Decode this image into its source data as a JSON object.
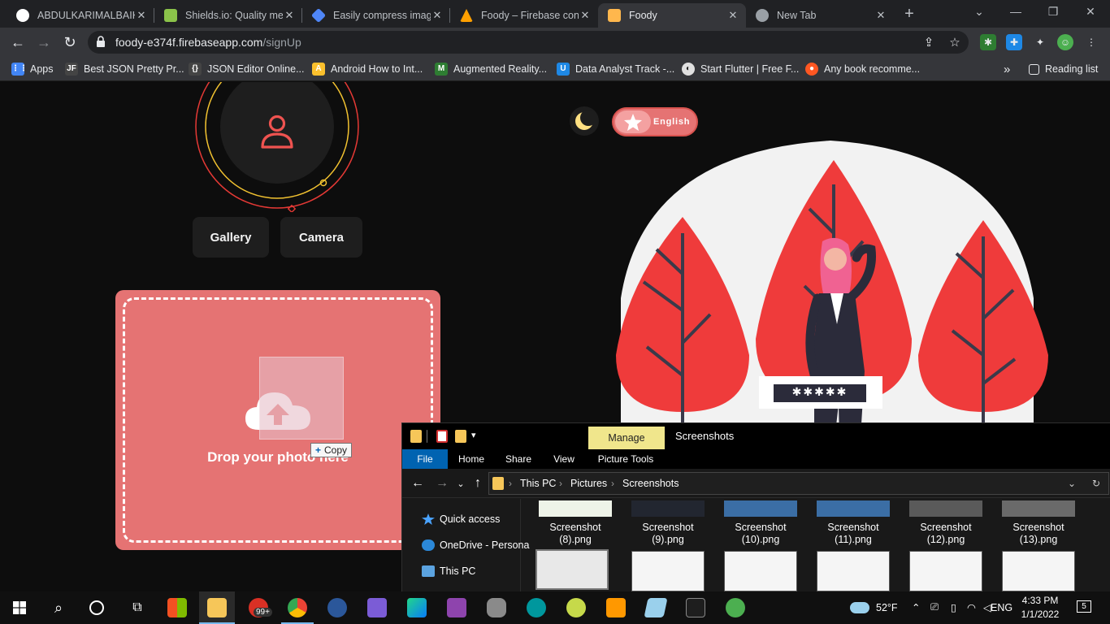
{
  "browser": {
    "tabs": [
      {
        "title": "ABDULKARIMALBAIK/",
        "favicon_color": "#ffffff",
        "active": false
      },
      {
        "title": "Shields.io: Quality met",
        "favicon_color": "#8bc34a",
        "active": false
      },
      {
        "title": "Easily compress image",
        "favicon_color": "#4f86f7",
        "active": false
      },
      {
        "title": "Foody – Firebase cons",
        "favicon_color": "#ffa000",
        "active": false
      },
      {
        "title": "Foody",
        "favicon_color": "#ffb74d",
        "active": true
      },
      {
        "title": "New Tab",
        "favicon_color": "#9aa0a6",
        "active": false
      }
    ],
    "tab_close": "✕",
    "new_tab": "+",
    "url_host": "foody-e374f.firebaseapp.com",
    "url_path": "/signUp",
    "bookmarks": [
      {
        "label": "Apps",
        "icon_color": "#4285f4",
        "glyph": "⋮⋮"
      },
      {
        "label": "Best JSON Pretty Pr...",
        "icon_color": "#444444",
        "glyph": "JF"
      },
      {
        "label": "JSON Editor Online...",
        "icon_color": "#444444",
        "glyph": "{}"
      },
      {
        "label": "Android How to Int...",
        "icon_color": "#fbc02d",
        "glyph": "A"
      },
      {
        "label": "Augmented Reality...",
        "icon_color": "#2e7d32",
        "glyph": "M"
      },
      {
        "label": "Data Analyst Track -...",
        "icon_color": "#1e88e5",
        "glyph": "U"
      },
      {
        "label": "Start Flutter | Free F...",
        "icon_color": "#e0e0e0",
        "glyph": "◐"
      },
      {
        "label": "Any book recomme...",
        "icon_color": "#ff5722",
        "glyph": "●"
      }
    ],
    "bookmarks_more": "»",
    "reading_list": "Reading list"
  },
  "page": {
    "gallery_label": "Gallery",
    "camera_label": "Camera",
    "drop_text": "Drop your photo here",
    "copy_tooltip": "Copy",
    "language": "English",
    "password_mask": "✱✱✱✱✱",
    "accent": "#e57373"
  },
  "explorer": {
    "manage": "Manage",
    "caption": "Screenshots",
    "ribbon_tabs": [
      "File",
      "Home",
      "Share",
      "View",
      "Picture Tools"
    ],
    "breadcrumb": [
      "This PC",
      "Pictures",
      "Screenshots"
    ],
    "nav_items": [
      {
        "label": "Quick access",
        "icon_color": "#4aa3ff"
      },
      {
        "label": "OneDrive - Persona",
        "icon_color": "#2b88d8"
      },
      {
        "label": "This PC",
        "icon_color": "#5ba3e0"
      }
    ],
    "files": [
      {
        "line1": "Screenshot",
        "line2": "(8).png"
      },
      {
        "line1": "Screenshot",
        "line2": "(9).png"
      },
      {
        "line1": "Screenshot",
        "line2": "(10).png"
      },
      {
        "line1": "Screenshot",
        "line2": "(11).png"
      },
      {
        "line1": "Screenshot",
        "line2": "(12).png"
      },
      {
        "line1": "Screenshot",
        "line2": "(13).png"
      }
    ]
  },
  "taskbar": {
    "badge": "99+",
    "weather": "52°F",
    "language": "ENG",
    "time": "4:33 PM",
    "date": "1/1/2022",
    "notifications": "5"
  }
}
